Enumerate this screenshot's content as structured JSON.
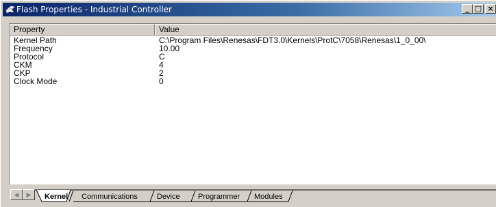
{
  "window": {
    "title": "Flash Properties - Industrial Controller",
    "controls": {
      "minimize": "_",
      "maximize": "□",
      "close": "×"
    }
  },
  "list": {
    "columns": [
      "Property",
      "Value"
    ],
    "rows": [
      {
        "property": "Kernel Path",
        "value": "C:\\Program Files\\Renesas\\FDT3.0\\Kernels\\ProtC\\7058\\Renesas\\1_0_00\\"
      },
      {
        "property": "Frequency",
        "value": "10.00"
      },
      {
        "property": "Protocol",
        "value": "C"
      },
      {
        "property": "CKM",
        "value": "4"
      },
      {
        "property": "CKP",
        "value": "2"
      },
      {
        "property": "Clock Mode",
        "value": "0"
      }
    ]
  },
  "tabs": {
    "active": "Kernel",
    "items": [
      "Kernel",
      "Communications",
      "Device",
      "Programmer",
      "Modules"
    ],
    "nav": {
      "left": "◀",
      "right": "▶"
    }
  },
  "colors": {
    "titlebar_start": "#0a246a",
    "titlebar_end": "#a6caf0",
    "face": "#d4d0c8"
  }
}
